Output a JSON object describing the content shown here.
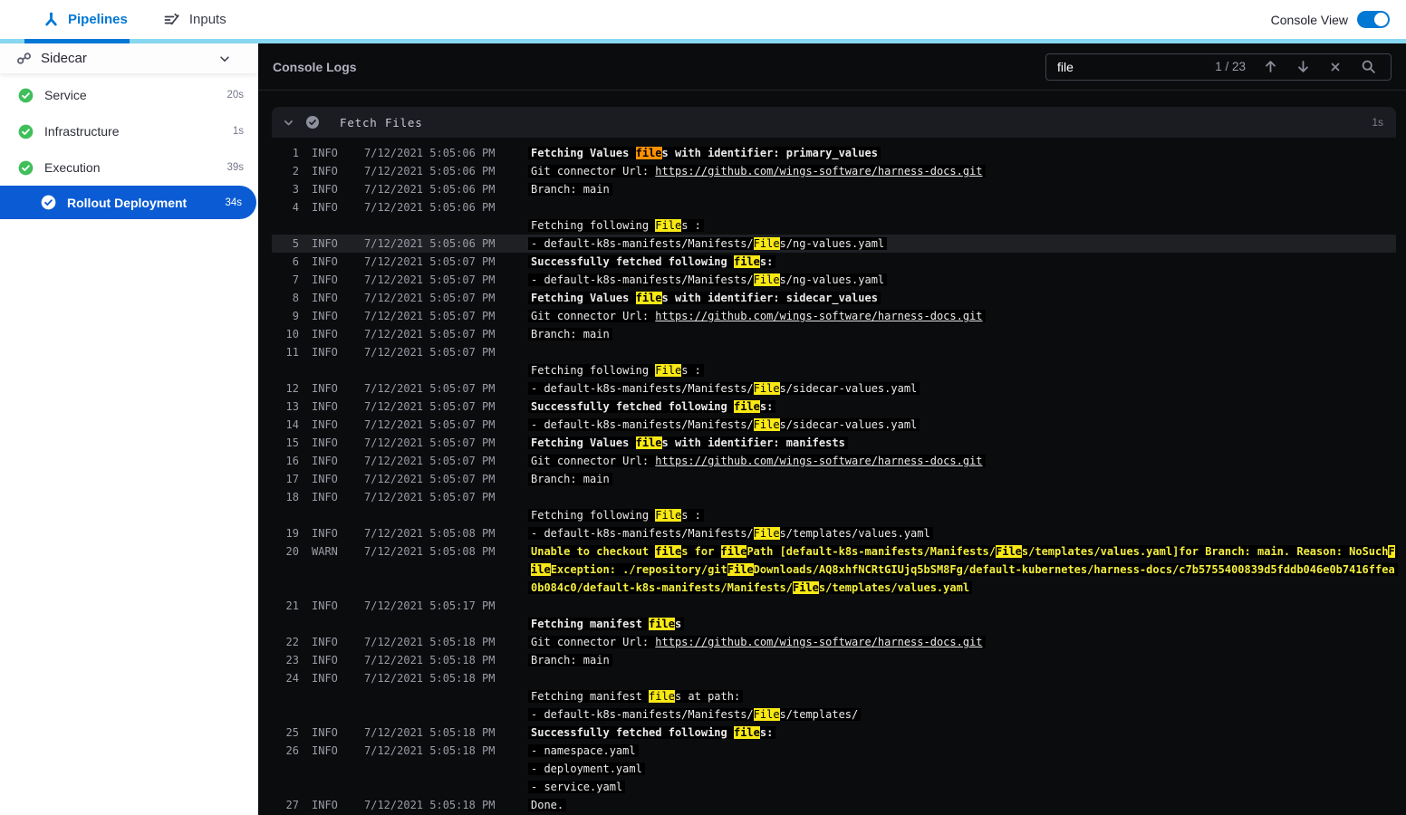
{
  "top_bar": {
    "tabs": [
      {
        "label": "Pipelines",
        "active": true
      },
      {
        "label": "Inputs",
        "active": false
      }
    ],
    "console_view_label": "Console View",
    "console_view_on": true
  },
  "sidebar": {
    "pipeline_name": "Sidecar",
    "stages": [
      {
        "label": "Service",
        "duration": "20s",
        "status": "success",
        "selected": false
      },
      {
        "label": "Infrastructure",
        "duration": "1s",
        "status": "success",
        "selected": false
      },
      {
        "label": "Execution",
        "duration": "39s",
        "status": "success",
        "selected": false
      },
      {
        "label": "Rollout Deployment",
        "duration": "34s",
        "status": "success",
        "selected": true
      }
    ]
  },
  "console": {
    "title": "Console Logs",
    "search": {
      "query": "file",
      "match_position": "1 / 23",
      "current_match": 1,
      "icons": [
        "arrow-up",
        "arrow-down",
        "close",
        "search"
      ]
    },
    "section": {
      "title": "Fetch Files",
      "duration": "1s",
      "status": "success"
    },
    "logs": [
      {
        "n": 1,
        "level": "INFO",
        "time": "7/12/2021 5:05:06 PM",
        "lines": [
          {
            "text": "Fetching Values files with identifier: primary_values",
            "bold": true
          }
        ]
      },
      {
        "n": 2,
        "level": "INFO",
        "time": "7/12/2021 5:05:06 PM",
        "lines": [
          {
            "text": "Git connector Url: https://github.com/wings-software/harness-docs.git"
          }
        ]
      },
      {
        "n": 3,
        "level": "INFO",
        "time": "7/12/2021 5:05:06 PM",
        "lines": [
          {
            "text": "Branch: main"
          }
        ]
      },
      {
        "n": 4,
        "level": "INFO",
        "time": "7/12/2021 5:05:06 PM",
        "lines": [
          {
            "text": ""
          },
          {
            "text": "Fetching following Files :"
          }
        ]
      },
      {
        "n": 5,
        "level": "INFO",
        "time": "7/12/2021 5:05:06 PM",
        "selected": true,
        "lines": [
          {
            "text": "- default-k8s-manifests/Manifests/Files/ng-values.yaml"
          }
        ]
      },
      {
        "n": 6,
        "level": "INFO",
        "time": "7/12/2021 5:05:07 PM",
        "lines": [
          {
            "text": "Successfully fetched following files:",
            "bold": true
          }
        ]
      },
      {
        "n": 7,
        "level": "INFO",
        "time": "7/12/2021 5:05:07 PM",
        "lines": [
          {
            "text": "- default-k8s-manifests/Manifests/Files/ng-values.yaml"
          }
        ]
      },
      {
        "n": 8,
        "level": "INFO",
        "time": "7/12/2021 5:05:07 PM",
        "lines": [
          {
            "text": "Fetching Values files with identifier: sidecar_values",
            "bold": true
          }
        ]
      },
      {
        "n": 9,
        "level": "INFO",
        "time": "7/12/2021 5:05:07 PM",
        "lines": [
          {
            "text": "Git connector Url: https://github.com/wings-software/harness-docs.git"
          }
        ]
      },
      {
        "n": 10,
        "level": "INFO",
        "time": "7/12/2021 5:05:07 PM",
        "lines": [
          {
            "text": "Branch: main"
          }
        ]
      },
      {
        "n": 11,
        "level": "INFO",
        "time": "7/12/2021 5:05:07 PM",
        "lines": [
          {
            "text": ""
          },
          {
            "text": "Fetching following Files :"
          }
        ]
      },
      {
        "n": 12,
        "level": "INFO",
        "time": "7/12/2021 5:05:07 PM",
        "lines": [
          {
            "text": "- default-k8s-manifests/Manifests/Files/sidecar-values.yaml"
          }
        ]
      },
      {
        "n": 13,
        "level": "INFO",
        "time": "7/12/2021 5:05:07 PM",
        "lines": [
          {
            "text": "Successfully fetched following files:",
            "bold": true
          }
        ]
      },
      {
        "n": 14,
        "level": "INFO",
        "time": "7/12/2021 5:05:07 PM",
        "lines": [
          {
            "text": "- default-k8s-manifests/Manifests/Files/sidecar-values.yaml"
          }
        ]
      },
      {
        "n": 15,
        "level": "INFO",
        "time": "7/12/2021 5:05:07 PM",
        "lines": [
          {
            "text": "Fetching Values files with identifier: manifests",
            "bold": true
          }
        ]
      },
      {
        "n": 16,
        "level": "INFO",
        "time": "7/12/2021 5:05:07 PM",
        "lines": [
          {
            "text": "Git connector Url: https://github.com/wings-software/harness-docs.git"
          }
        ]
      },
      {
        "n": 17,
        "level": "INFO",
        "time": "7/12/2021 5:05:07 PM",
        "lines": [
          {
            "text": "Branch: main"
          }
        ]
      },
      {
        "n": 18,
        "level": "INFO",
        "time": "7/12/2021 5:05:07 PM",
        "lines": [
          {
            "text": ""
          },
          {
            "text": "Fetching following Files :"
          }
        ]
      },
      {
        "n": 19,
        "level": "INFO",
        "time": "7/12/2021 5:05:08 PM",
        "lines": [
          {
            "text": "- default-k8s-manifests/Manifests/Files/templates/values.yaml"
          }
        ]
      },
      {
        "n": 20,
        "level": "WARN",
        "time": "7/12/2021 5:05:08 PM",
        "lines": [
          {
            "text": "Unable to checkout files for filePath [default-k8s-manifests/Manifests/Files/templates/values.yaml]for Branch: main. Reason: NoSuchFileException: ./repository/gitFileDownloads/AQ8xhfNCRtGIUjq5bSM8Fg/default-kubernetes/harness-docs/c7b5755400839d5fddb046e0b7416ffea0b084c0/default-k8s-manifests/Manifests/Files/templates/values.yaml",
            "bold": true,
            "warn": true
          }
        ]
      },
      {
        "n": 21,
        "level": "INFO",
        "time": "7/12/2021 5:05:17 PM",
        "lines": [
          {
            "text": ""
          },
          {
            "text": "Fetching manifest files",
            "bold": true
          }
        ]
      },
      {
        "n": 22,
        "level": "INFO",
        "time": "7/12/2021 5:05:18 PM",
        "lines": [
          {
            "text": "Git connector Url: https://github.com/wings-software/harness-docs.git"
          }
        ]
      },
      {
        "n": 23,
        "level": "INFO",
        "time": "7/12/2021 5:05:18 PM",
        "lines": [
          {
            "text": "Branch: main"
          }
        ]
      },
      {
        "n": 24,
        "level": "INFO",
        "time": "7/12/2021 5:05:18 PM",
        "lines": [
          {
            "text": ""
          },
          {
            "text": "Fetching manifest files at path:"
          },
          {
            "text": "- default-k8s-manifests/Manifests/Files/templates/"
          }
        ]
      },
      {
        "n": 25,
        "level": "INFO",
        "time": "7/12/2021 5:05:18 PM",
        "lines": [
          {
            "text": "Successfully fetched following files:",
            "bold": true
          }
        ]
      },
      {
        "n": 26,
        "level": "INFO",
        "time": "7/12/2021 5:05:18 PM",
        "lines": [
          {
            "text": "- namespace.yaml"
          },
          {
            "text": "- deployment.yaml"
          },
          {
            "text": "- service.yaml"
          }
        ]
      },
      {
        "n": 27,
        "level": "INFO",
        "time": "7/12/2021 5:05:18 PM",
        "lines": [
          {
            "text": "Done."
          }
        ]
      }
    ]
  },
  "colors": {
    "accent_blue": "#0278d5",
    "tab_strip_cyan": "#89d8f2",
    "success_green": "#3fbf5a",
    "selected_stage_blue": "#0b5cd4",
    "search_highlight_yellow": "#f8e814",
    "current_match_orange": "#ff9102",
    "warn_text_yellow": "#f3ee3e",
    "console_background": "#0b0c0e"
  }
}
